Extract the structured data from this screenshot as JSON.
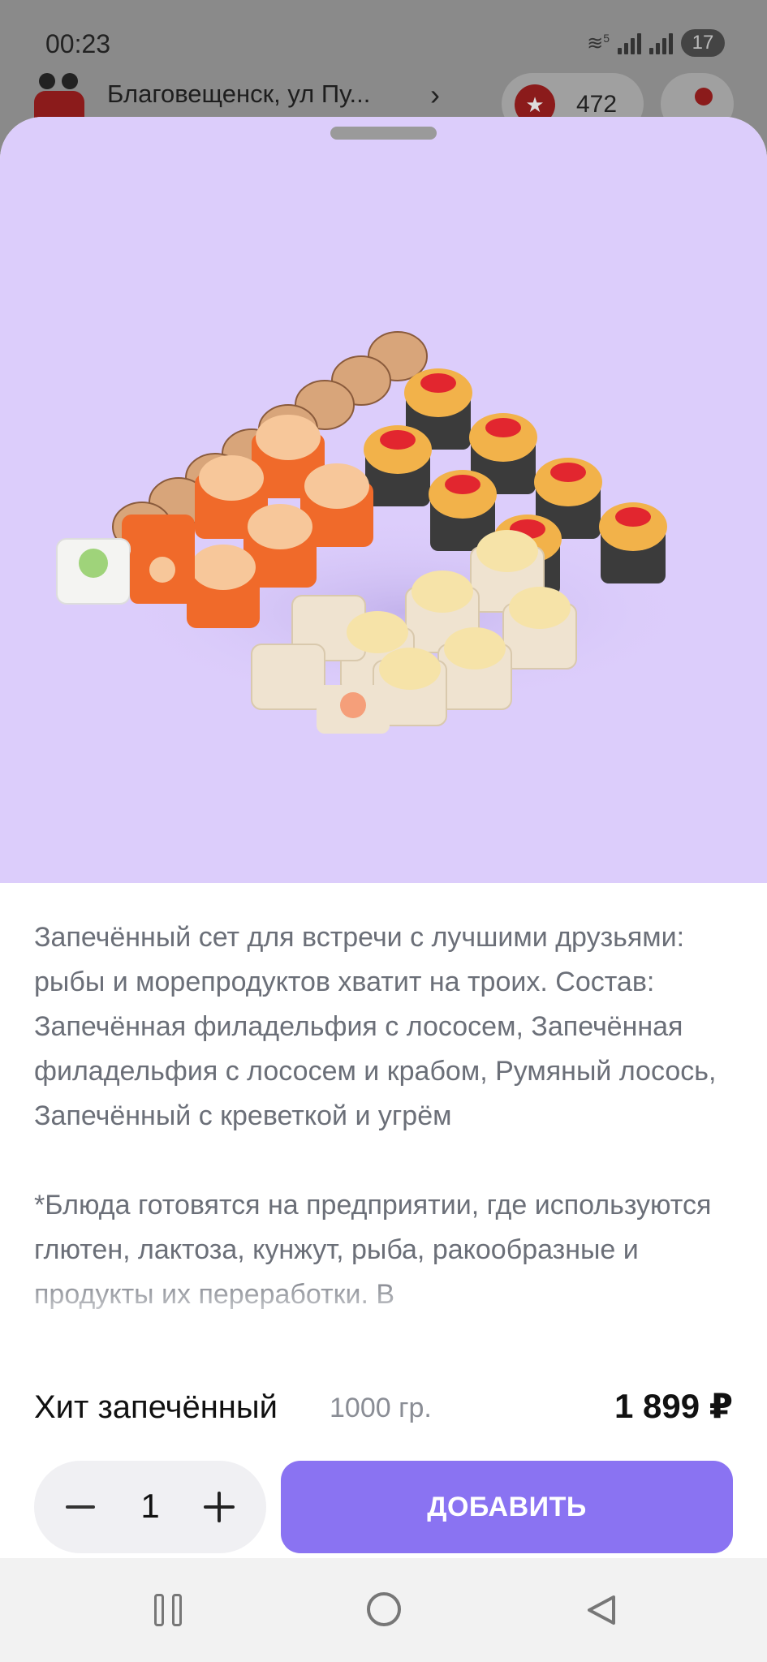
{
  "status_bar": {
    "time": "00:23",
    "network": "5",
    "battery": "17"
  },
  "background_app": {
    "address": "Благовещенск, ул Пу...",
    "bonus_count": "472",
    "bonus_icon": "star-icon",
    "bell_icon": "bell-icon"
  },
  "product": {
    "image_icon": "sushi-set-image",
    "description_paragraphs": [
      "Запечённый сет для встречи с лучшими друзьями: рыбы и морепродуктов хватит на троих. Состав: Запечённая филадельфия с лососем, Запечённая филадельфия с лососем и крабом, Румяный лосось, Запечённый с креветкой и угрём",
      "*Блюда готовятся на предприятии, где используются глютен, лактоза, кунжут, рыба, ракообразные и продукты их переработки. В"
    ],
    "name": "Хит запечённый",
    "weight": "1000 гр.",
    "price": "1 899 ₽"
  },
  "cart_controls": {
    "quantity": "1",
    "add_label": "ДОБАВИТЬ"
  },
  "colors": {
    "hero_bg": "#dccdfb",
    "accent": "#8a73f2",
    "text_muted": "#6b6f78"
  }
}
